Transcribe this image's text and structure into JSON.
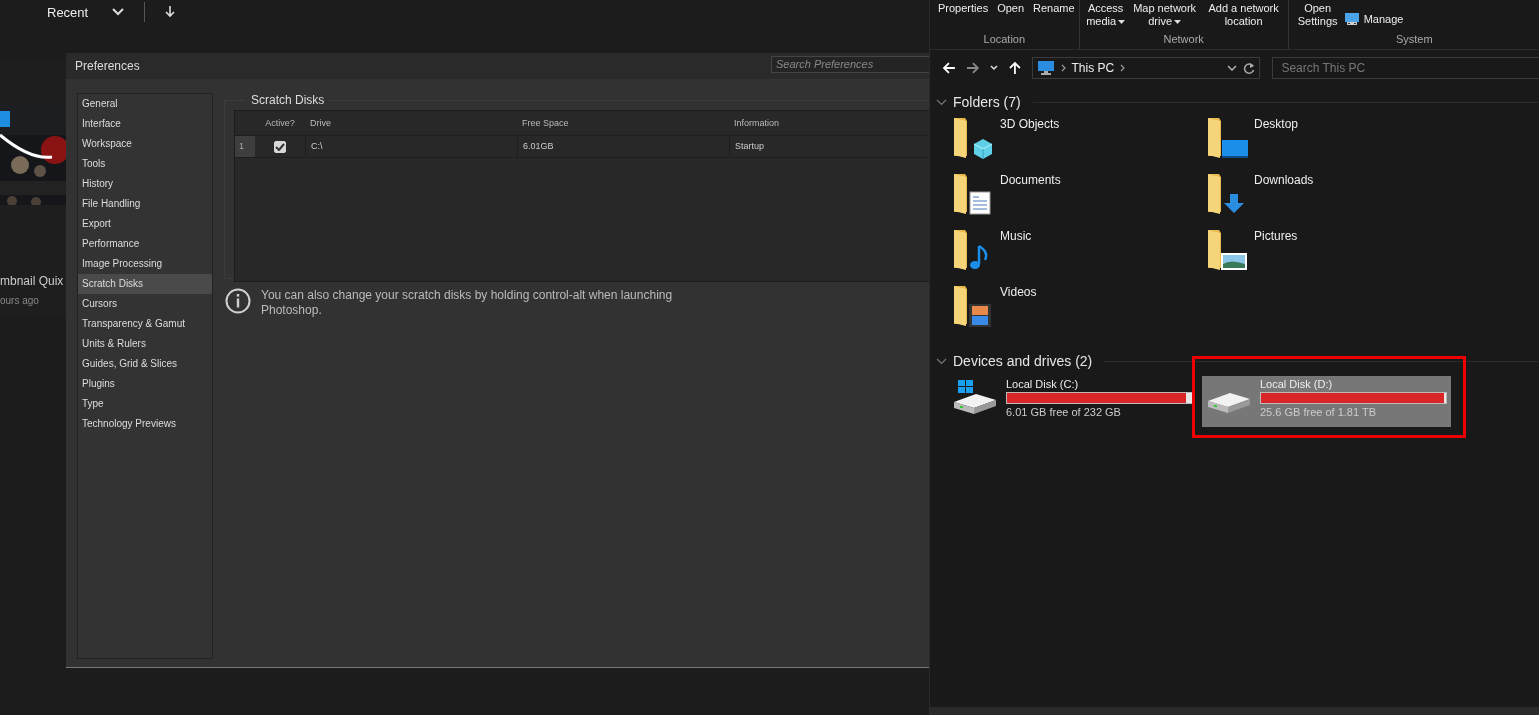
{
  "home": {
    "tab_label": "Recent",
    "card": {
      "title": "mbnail Quix",
      "meta": "ours ago"
    }
  },
  "preferences": {
    "title": "Preferences",
    "search": {
      "placeholder": "Search Preferences"
    },
    "sidebar": {
      "items": [
        {
          "label": "General",
          "selected": false
        },
        {
          "label": "Interface",
          "selected": false
        },
        {
          "label": "Workspace",
          "selected": false
        },
        {
          "label": "Tools",
          "selected": false
        },
        {
          "label": "History",
          "selected": false
        },
        {
          "label": "File Handling",
          "selected": false
        },
        {
          "label": "Export",
          "selected": false
        },
        {
          "label": "Performance",
          "selected": false
        },
        {
          "label": "Image Processing",
          "selected": false
        },
        {
          "label": "Scratch Disks",
          "selected": true
        },
        {
          "label": "Cursors",
          "selected": false
        },
        {
          "label": "Transparency & Gamut",
          "selected": false
        },
        {
          "label": "Units & Rulers",
          "selected": false
        },
        {
          "label": "Guides, Grid & Slices",
          "selected": false
        },
        {
          "label": "Plugins",
          "selected": false
        },
        {
          "label": "Type",
          "selected": false
        },
        {
          "label": "Technology Previews",
          "selected": false
        }
      ]
    },
    "scratch_disks": {
      "title": "Scratch Disks",
      "columns": [
        "Active?",
        "Drive",
        "Free Space",
        "Information"
      ],
      "rows": [
        {
          "index": "1",
          "active": true,
          "drive": "C:\\",
          "free_space": "6.01GB",
          "information": "Startup"
        }
      ]
    },
    "note": "You can also change your scratch disks by holding control-alt when launching Photoshop."
  },
  "explorer": {
    "ribbon": {
      "groups": [
        {
          "label": "Location",
          "buttons": [
            {
              "label": "Properties",
              "dropdown": false
            },
            {
              "label": "Open",
              "dropdown": false
            },
            {
              "label": "Rename",
              "dropdown": false
            }
          ]
        },
        {
          "label": "Network",
          "buttons": [
            {
              "label": "Access media",
              "dropdown": true
            },
            {
              "label": "Map network drive",
              "dropdown": true
            },
            {
              "label": "Add a network location",
              "dropdown": false
            }
          ]
        },
        {
          "label": "System",
          "buttons": [
            {
              "label": "Open Settings",
              "dropdown": false
            },
            {
              "label": "Manage",
              "dropdown": false
            }
          ]
        }
      ]
    },
    "address": {
      "path": "This PC"
    },
    "search": {
      "placeholder": "Search This PC"
    },
    "folders": {
      "title": "Folders (7)",
      "expanded": true,
      "items": [
        {
          "name": "3D Objects",
          "kind": "objects"
        },
        {
          "name": "Desktop",
          "kind": "desktop"
        },
        {
          "name": "Documents",
          "kind": "documents"
        },
        {
          "name": "Downloads",
          "kind": "downloads"
        },
        {
          "name": "Music",
          "kind": "music"
        },
        {
          "name": "Pictures",
          "kind": "pictures"
        },
        {
          "name": "Videos",
          "kind": "videos"
        }
      ]
    },
    "drives": {
      "title": "Devices and drives (2)",
      "expanded": true,
      "items": [
        {
          "name": "Local Disk (C:)",
          "kind": "system",
          "level": 0.97,
          "free": "6.01 GB free of 232 GB",
          "selected": false,
          "highlighted": false
        },
        {
          "name": "Local Disk (D:)",
          "kind": "data",
          "level": 0.99,
          "free": "25.6 GB free of 1.81 TB",
          "selected": true,
          "highlighted": true
        }
      ]
    }
  }
}
